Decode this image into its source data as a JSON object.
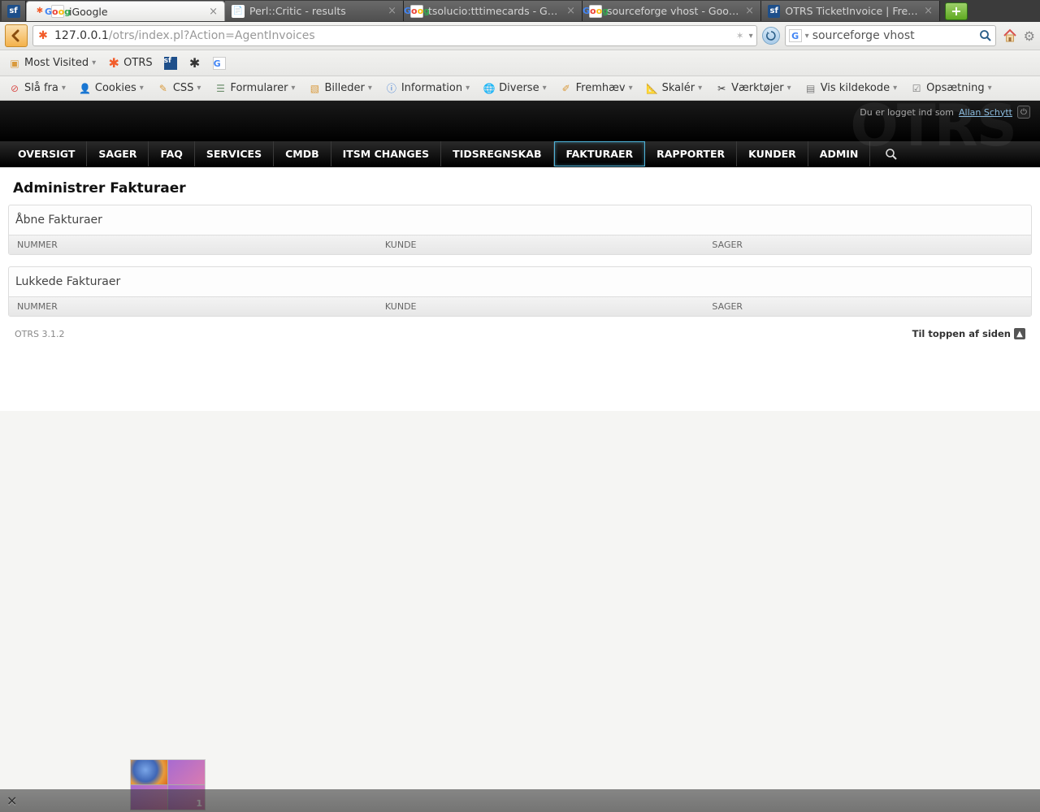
{
  "tabs": [
    {
      "label": "",
      "type": "sf"
    },
    {
      "label": "iGoogle",
      "type": "google",
      "active": true,
      "closable": true
    },
    {
      "label": "Perl::Critic - results",
      "type": "generic",
      "closable": true
    },
    {
      "label": "tsolucio:tttimecards - Go…",
      "type": "google",
      "closable": true
    },
    {
      "label": "sourceforge vhost - Goo…",
      "type": "google",
      "closable": true
    },
    {
      "label": "OTRS TicketInvoice | Free…",
      "type": "sf",
      "closable": true
    }
  ],
  "url": {
    "host": "127.0.0.1",
    "path": "/otrs/index.pl?Action=AgentInvoices"
  },
  "search": {
    "value": "sourceforge vhost"
  },
  "bookmarks": {
    "most_visited": "Most Visited",
    "otrs": "OTRS"
  },
  "devtools": {
    "disable": "Slå fra",
    "cookies": "Cookies",
    "css": "CSS",
    "forms": "Formularer",
    "images": "Billeder",
    "info": "Information",
    "misc": "Diverse",
    "highlight": "Fremhæv",
    "scale": "Skalér",
    "tools": "Værktøjer",
    "source": "Vis kildekode",
    "setup": "Opsætning"
  },
  "header": {
    "logged_in_as": "Du er logget ind som ",
    "user": "Allan Schytt"
  },
  "nav": [
    "OVERSIGT",
    "SAGER",
    "FAQ",
    "SERVICES",
    "CMDB",
    "ITSM CHANGES",
    "TIDSREGNSKAB",
    "FAKTURAER",
    "RAPPORTER",
    "KUNDER",
    "ADMIN"
  ],
  "nav_active": "FAKTURAER",
  "page": {
    "title": "Administrer Fakturaer",
    "open_title": "Åbne Fakturaer",
    "closed_title": "Lukkede Fakturaer",
    "cols": {
      "num": "NUMMER",
      "kunde": "KUNDE",
      "sager": "SAGER"
    }
  },
  "footer": {
    "version": "OTRS 3.1.2",
    "to_top": "Til toppen af siden"
  },
  "taskbar": {
    "badge": "1"
  }
}
